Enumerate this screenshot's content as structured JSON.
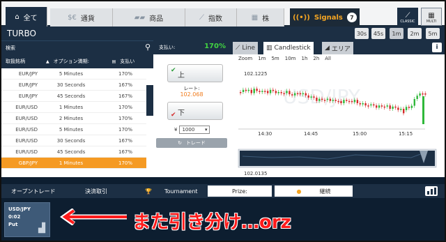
{
  "nav": {
    "tabs": [
      {
        "label": "全て",
        "icon": "home-icon"
      },
      {
        "label": "通貨",
        "icon": "currency-icon"
      },
      {
        "label": "商品",
        "icon": "commodity-icon"
      },
      {
        "label": "指数",
        "icon": "chart-index-icon"
      },
      {
        "label": "株",
        "icon": "stock-icon"
      }
    ],
    "signals_label": "Signals",
    "signals_count": "7",
    "view_classic": "CLASSIC",
    "view_multi": "MULTI"
  },
  "mode": {
    "title": "TURBO",
    "times": [
      "30s",
      "45s",
      "1m",
      "2m",
      "5m"
    ],
    "selected_time": "1m"
  },
  "assets": {
    "search_label": "検索",
    "headers": [
      "取扱銘柄",
      "オプション満期:",
      "支払い"
    ],
    "rows": [
      {
        "asset": "EUR/JPY",
        "expiry": "5 Minutes",
        "payout": "170%"
      },
      {
        "asset": "EUR/JPY",
        "expiry": "30 Seconds",
        "payout": "167%"
      },
      {
        "asset": "EUR/JPY",
        "expiry": "45 Seconds",
        "payout": "167%"
      },
      {
        "asset": "EUR/USD",
        "expiry": "1 Minutes",
        "payout": "170%"
      },
      {
        "asset": "EUR/USD",
        "expiry": "2 Minutes",
        "payout": "170%"
      },
      {
        "asset": "EUR/USD",
        "expiry": "5 Minutes",
        "payout": "170%"
      },
      {
        "asset": "EUR/USD",
        "expiry": "30 Seconds",
        "payout": "167%"
      },
      {
        "asset": "EUR/USD",
        "expiry": "45 Seconds",
        "payout": "167%"
      },
      {
        "asset": "GBP/JPY",
        "expiry": "1 Minutes",
        "payout": "170%"
      }
    ]
  },
  "trade": {
    "payout_label": "支払い:",
    "payout_value": "170%",
    "up_label": "上",
    "down_label": "下",
    "rate_label": "レート:",
    "rate_value": "102.068",
    "amount_prefix": "¥",
    "amount_value": "1000",
    "trade_label": "トレード"
  },
  "chart": {
    "tabs": [
      "Line",
      "Candlestick",
      "エリア"
    ],
    "active_tab": "Candlestick",
    "zoom_label": "Zoom",
    "zoom_options": [
      "1m",
      "5m",
      "10m",
      "1h",
      "2h",
      "All"
    ],
    "watermark": "USD/JPY",
    "price_top": "102.1225",
    "price_bottom": "102.0135",
    "time_labels": [
      "14:30",
      "14:45",
      "15:00",
      "15:15"
    ],
    "up_color": "#2fb83a",
    "down_color": "#d42a2a"
  },
  "chart_data": {
    "type": "candlestick",
    "x": [
      "14:30",
      "14:45",
      "15:00",
      "15:15"
    ],
    "ylim": [
      102.0135,
      102.1225
    ],
    "title": "USD/JPY"
  },
  "bottom": {
    "open_trades": "オープントレード",
    "closed_trades": "決済取引",
    "tournament": "Tournament",
    "prize": "Prize:",
    "continue": "継続"
  },
  "position": {
    "asset": "USD/JPY",
    "time": "0:02",
    "type": "Put"
  },
  "annotation": {
    "text": "また引き分け…orz"
  }
}
